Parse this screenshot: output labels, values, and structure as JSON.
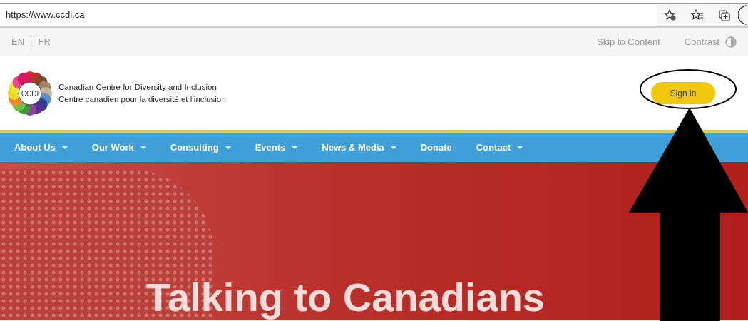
{
  "browser": {
    "url": "https://www.ccdi.ca"
  },
  "utility_bar": {
    "languages": [
      "EN",
      "FR"
    ],
    "separator": "|",
    "skip_link": "Skip to Content",
    "contrast": "Contrast"
  },
  "header": {
    "logo_text": "CCDI",
    "org_name_en": "Canadian Centre for Diversity and Inclusion",
    "org_name_fr": "Centre canadien pour la diversité et l’inclusion",
    "sign_in": "Sign in"
  },
  "nav": [
    {
      "label": "About Us",
      "dropdown": true
    },
    {
      "label": "Our Work",
      "dropdown": true
    },
    {
      "label": "Consulting",
      "dropdown": true
    },
    {
      "label": "Events",
      "dropdown": true
    },
    {
      "label": "News & Media",
      "dropdown": true
    },
    {
      "label": "Donate",
      "dropdown": false
    },
    {
      "label": "Contact",
      "dropdown": true
    }
  ],
  "hero": {
    "title": "Talking to Canadians"
  }
}
